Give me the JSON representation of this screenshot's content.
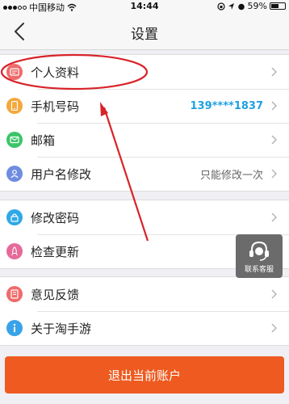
{
  "status_bar": {
    "carrier": "中国移动",
    "time": "14:44",
    "battery_percent": "59%",
    "battery_level": 0.59
  },
  "nav": {
    "title": "设置"
  },
  "groups": [
    {
      "items": [
        {
          "label": "个人资料",
          "icon": "profile-card-icon",
          "color": "#ef6b6b"
        },
        {
          "label": "手机号码",
          "icon": "phone-icon",
          "color": "#f4a73b",
          "value": "139****1837"
        },
        {
          "label": "邮箱",
          "icon": "mail-icon",
          "color": "#3cc46a"
        },
        {
          "label": "用户名修改",
          "icon": "user-icon",
          "color": "#6f8de0",
          "value": "只能修改一次"
        }
      ]
    },
    {
      "items": [
        {
          "label": "修改密码",
          "icon": "lock-icon",
          "color": "#2fa8e6"
        },
        {
          "label": "检查更新",
          "icon": "rocket-icon",
          "color": "#e56a9a"
        }
      ]
    },
    {
      "items": [
        {
          "label": "意见反馈",
          "icon": "feedback-icon",
          "color": "#ef6b6b"
        },
        {
          "label": "关于淘手游",
          "icon": "info-icon",
          "color": "#3aa3e8"
        }
      ]
    }
  ],
  "customer_service": {
    "label": "联系客服",
    "icon": "headset-icon"
  },
  "logout": {
    "label": "退出当前账户",
    "color": "#ee5a1f"
  },
  "annotation": {
    "color": "#d8232a"
  }
}
